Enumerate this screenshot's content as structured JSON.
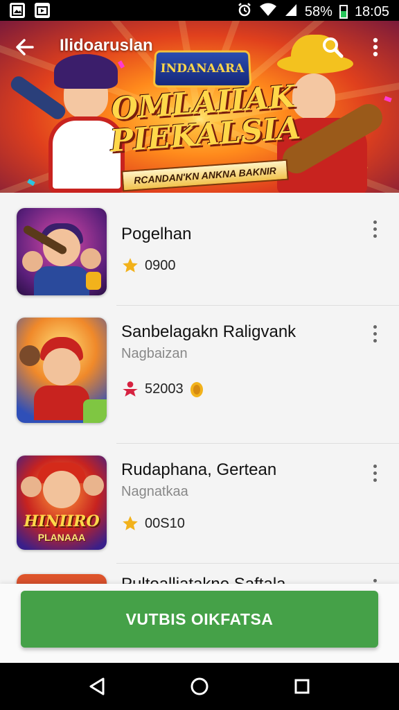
{
  "status_bar": {
    "battery_text": "58%",
    "time": "18:05",
    "icons": [
      "image-icon",
      "play-store-icon",
      "alarm-icon",
      "wifi-icon",
      "signal-icon",
      "battery-icon"
    ],
    "battery_level": 0.58
  },
  "header": {
    "title": "Ilidoaruslan",
    "back_icon": "arrow-left-icon",
    "search_icon": "search-icon",
    "menu_icon": "more-vertical-icon"
  },
  "banner": {
    "logo_text": "INDANAARA",
    "headline_line1": "OMLAIIAK",
    "headline_line2": "PIEKALSIA",
    "ribbon_text": "RCANDAN'KN ANKNA BAKNIR"
  },
  "items": [
    {
      "title": "Pogelhan",
      "subtitle": "",
      "badge_icon": "star-icon",
      "badge_color": "#f2b21b",
      "count": "0900",
      "extra_icon": ""
    },
    {
      "title": "Sanbelagakn Raligvank",
      "subtitle": "Nagbaizan",
      "badge_icon": "person-icon",
      "badge_color": "#d62240",
      "count": "52003",
      "extra_icon": "medal-icon"
    },
    {
      "title": "Rudaphana, Gertean",
      "subtitle": "Nagnatkaa",
      "badge_icon": "star-icon",
      "badge_color": "#f2b21b",
      "count": "00S10",
      "extra_icon": "",
      "thumb_caption": "HINIIRO",
      "thumb_caption2": "PLANAAA"
    },
    {
      "title": "Pultoalliatakne Saftala",
      "subtitle": "",
      "count": ""
    }
  ],
  "cta": {
    "label": "VUTBIS OIKFATSA"
  },
  "nav": {
    "back_icon": "triangle-back-icon",
    "home_icon": "circle-home-icon",
    "recents_icon": "square-recents-icon"
  },
  "colors": {
    "accent_green": "#45a148",
    "star_yellow": "#f2b21b",
    "person_red": "#d62240"
  }
}
